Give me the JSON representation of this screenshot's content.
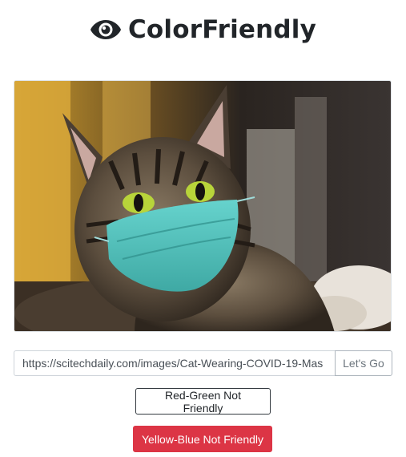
{
  "header": {
    "icon": "eye-icon",
    "title": "ColorFriendly"
  },
  "photo": {
    "subject": "cat-photo"
  },
  "url_form": {
    "value": "https://scitechdaily.com/images/Cat-Wearing-COVID-19-Mas",
    "go_label": "Let's Go"
  },
  "buttons": {
    "red_green_label": "Red-Green Not Friendly",
    "yellow_blue_label": "Yellow-Blue Not Friendly"
  },
  "colors": {
    "title": "#212529",
    "danger": "#dc3545",
    "outline_dark": "#343a40",
    "mask": "#5cc9c4",
    "cat_eyes": "#b8d43a"
  }
}
